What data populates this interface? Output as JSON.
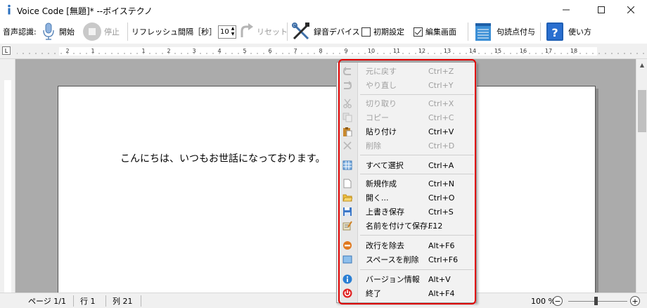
{
  "window": {
    "title": "Voice Code [無題]* --ボイステクノ"
  },
  "toolbar": {
    "recognition_label": "音声認識:",
    "start_label": "開始",
    "stop_label": "停止",
    "refresh_label": "リフレッシュ間隔［秒］",
    "refresh_value": "10",
    "reset_label": "リセット",
    "device_label": "録音デバイス",
    "initial_settings_label": "初期設定",
    "edit_screen_label": "編集画面",
    "punctuation_label": "句読点付与",
    "help_label": "使い方",
    "edit_screen_checked": true,
    "initial_settings_checked": false
  },
  "ruler": {
    "tab_marker": "L",
    "numbers": [
      "2",
      "1",
      "1",
      "2",
      "3",
      "4",
      "5",
      "6",
      "7",
      "8",
      "9",
      "10",
      "11",
      "12",
      "13",
      "14",
      "15",
      "16",
      "17",
      "18"
    ]
  },
  "document": {
    "text": "こんにちは、いつもお世話になっております。"
  },
  "statusbar": {
    "page": "ページ 1/1",
    "line": "行 1",
    "column": "列 21",
    "zoom": "100 %",
    "zoom_out": "−",
    "zoom_in": "+"
  },
  "context_menu": {
    "items": [
      {
        "label": "元に戻す",
        "shortcut": "Ctrl+Z",
        "icon": "undo-icon",
        "enabled": false
      },
      {
        "label": "やり直し",
        "shortcut": "Ctrl+Y",
        "icon": "redo-icon",
        "enabled": false
      },
      {
        "label": "切り取り",
        "shortcut": "Ctrl+X",
        "icon": "cut-icon",
        "enabled": false
      },
      {
        "label": "コピー",
        "shortcut": "Ctrl+C",
        "icon": "copy-icon",
        "enabled": false
      },
      {
        "label": "貼り付け",
        "shortcut": "Ctrl+V",
        "icon": "paste-icon",
        "enabled": true
      },
      {
        "label": "削除",
        "shortcut": "Ctrl+D",
        "icon": "delete-icon",
        "enabled": false
      },
      {
        "label": "すべて選択",
        "shortcut": "Ctrl+A",
        "icon": "select-all-icon",
        "enabled": true
      },
      {
        "label": "新規作成",
        "shortcut": "Ctrl+N",
        "icon": "new-file-icon",
        "enabled": true
      },
      {
        "label": "開く...",
        "shortcut": "Ctrl+O",
        "icon": "open-folder-icon",
        "enabled": true
      },
      {
        "label": "上書き保存",
        "shortcut": "Ctrl+S",
        "icon": "save-icon",
        "enabled": true
      },
      {
        "label": "名前を付けて保存...",
        "shortcut": "F12",
        "icon": "save-as-icon",
        "enabled": true
      },
      {
        "label": "改行を除去",
        "shortcut": "Alt+F6",
        "icon": "remove-linebreak-icon",
        "enabled": true
      },
      {
        "label": "スペースを削除",
        "shortcut": "Ctrl+F6",
        "icon": "remove-space-icon",
        "enabled": true
      },
      {
        "label": "バージョン情報",
        "shortcut": "Alt+V",
        "icon": "info-icon",
        "enabled": true
      },
      {
        "label": "終了",
        "shortcut": "Alt+F4",
        "icon": "power-icon",
        "enabled": true
      }
    ]
  },
  "colors": {
    "highlight": "#e00000",
    "doc_background": "#ababab",
    "help_blue": "#1f5fb5"
  }
}
